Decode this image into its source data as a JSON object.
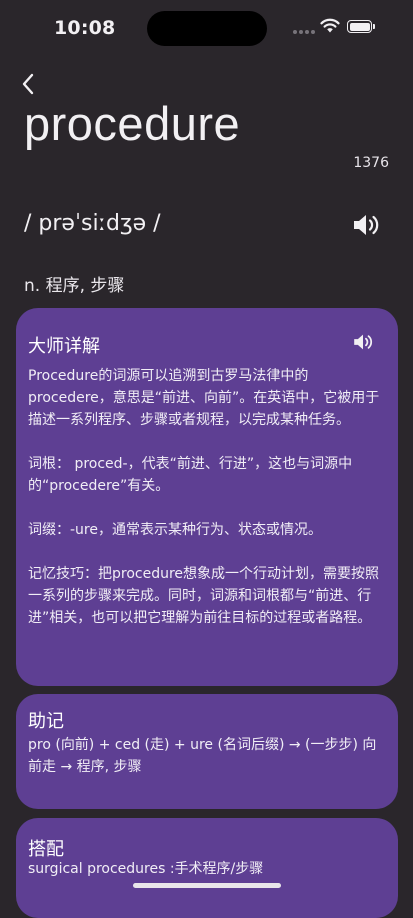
{
  "status_bar": {
    "time": "10:08"
  },
  "header": {
    "word": "procedure",
    "frequency": "1376",
    "phonetic": "/ prəˈsiːdʒə /",
    "definition": "n. 程序, 步骤"
  },
  "master_card": {
    "title": "大师详解",
    "body": "Procedure的词源可以追溯到古罗马法律中的procedere，意思是“前进、向前”。在英语中，它被用于描述一系列程序、步骤或者规程，以完成某种任务。\n\n词根： proced-，代表“前进、行进”，这也与词源中的“procedere”有关。\n\n词缀：-ure，通常表示某种行为、状态或情况。\n\n记忆技巧：把procedure想象成一个行动计划，需要按照一系列的步骤来完成。同时，词源和词根都与“前进、行进”相关，也可以把它理解为前往目标的过程或者路程。"
  },
  "mnemonic_card": {
    "title": "助记",
    "body": "pro (向前) + ced (走) + ure (名词后缀) → (一步步) 向前走 → 程序, 步骤"
  },
  "collocation_card": {
    "title": "搭配",
    "body": "surgical procedures :手术程序/步骤"
  },
  "icons": {
    "back": "chevron-left-icon",
    "speaker": "speaker-icon",
    "wifi": "wifi-icon",
    "battery": "battery-icon"
  }
}
